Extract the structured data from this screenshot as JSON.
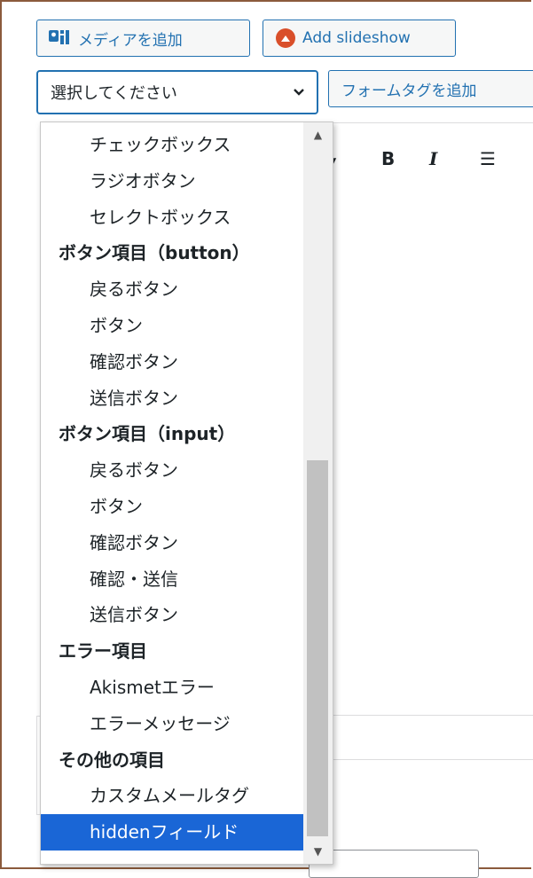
{
  "toolbar": {
    "add_media_label": "メディアを追加",
    "add_slideshow_label": "Add slideshow",
    "add_form_tag_label": "フォームタグを追加"
  },
  "select": {
    "current_value": "選択してください"
  },
  "editor": {
    "toolbar_icons": [
      "bold-icon",
      "italic-icon",
      "bullet-list-icon"
    ],
    "bold_glyph": "B",
    "italic_glyph": "I",
    "list_glyph": "☰"
  },
  "dropdown": {
    "options": [
      {
        "label": "チェックボックス",
        "group": false,
        "selected": false
      },
      {
        "label": "ラジオボタン",
        "group": false,
        "selected": false
      },
      {
        "label": "セレクトボックス",
        "group": false,
        "selected": false
      },
      {
        "label": "ボタン項目（button）",
        "group": true,
        "selected": false
      },
      {
        "label": "戻るボタン",
        "group": false,
        "selected": false
      },
      {
        "label": "ボタン",
        "group": false,
        "selected": false
      },
      {
        "label": "確認ボタン",
        "group": false,
        "selected": false
      },
      {
        "label": "送信ボタン",
        "group": false,
        "selected": false
      },
      {
        "label": "ボタン項目（input）",
        "group": true,
        "selected": false
      },
      {
        "label": "戻るボタン",
        "group": false,
        "selected": false
      },
      {
        "label": "ボタン",
        "group": false,
        "selected": false
      },
      {
        "label": "確認ボタン",
        "group": false,
        "selected": false
      },
      {
        "label": "確認・送信",
        "group": false,
        "selected": false
      },
      {
        "label": "送信ボタン",
        "group": false,
        "selected": false
      },
      {
        "label": "エラー項目",
        "group": true,
        "selected": false
      },
      {
        "label": "Akismetエラー",
        "group": false,
        "selected": false
      },
      {
        "label": "エラーメッセージ",
        "group": false,
        "selected": false
      },
      {
        "label": "その他の項目",
        "group": true,
        "selected": false
      },
      {
        "label": "カスタムメールタグ",
        "group": false,
        "selected": false
      },
      {
        "label": "hiddenフィールド",
        "group": false,
        "selected": true
      }
    ]
  },
  "colors": {
    "accent": "#2271b1",
    "selected_bg": "#1a66d6",
    "slideshow_icon": "#d94f2a"
  }
}
